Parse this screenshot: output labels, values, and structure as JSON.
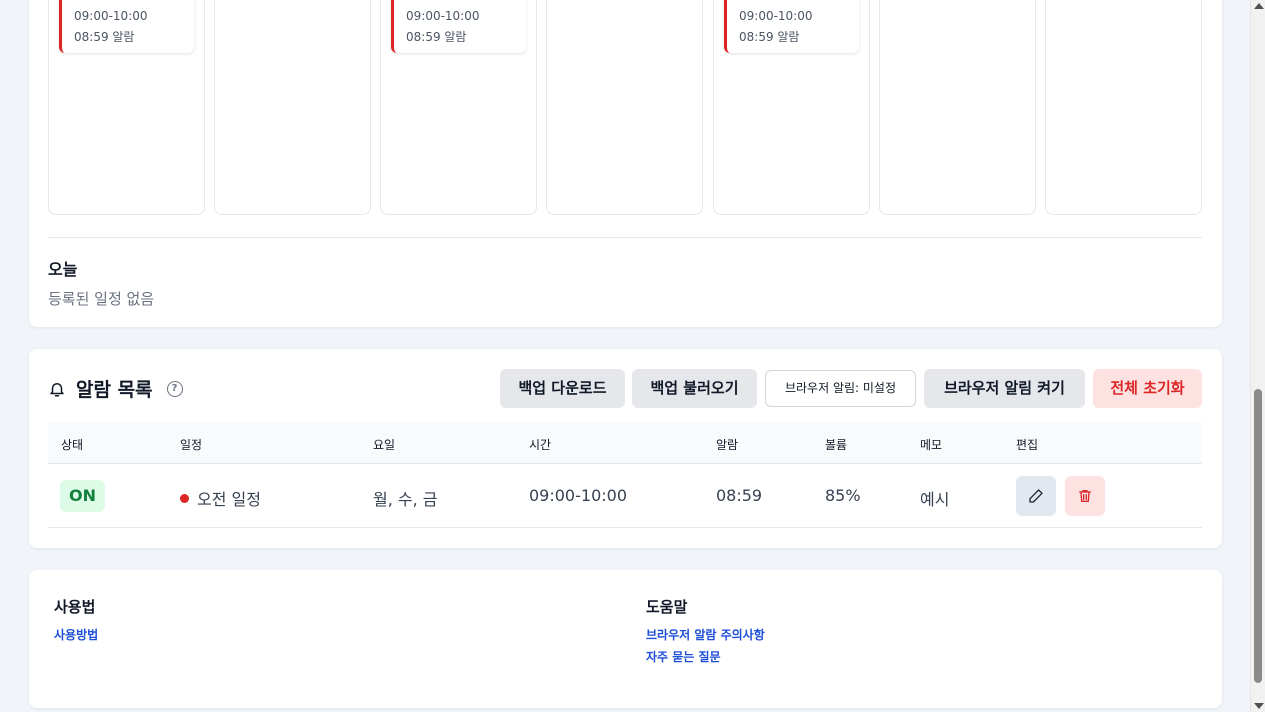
{
  "week": {
    "events": [
      {
        "time": "09:00-10:00",
        "alarm": "08:59 알람"
      },
      {
        "time": "09:00-10:00",
        "alarm": "08:59 알람"
      },
      {
        "time": "09:00-10:00",
        "alarm": "08:59 알람"
      }
    ],
    "today_title": "오늘",
    "today_empty": "등록된 일정 없음",
    "event_color": "#dc2626"
  },
  "alarms": {
    "title": "알람 목록",
    "help_icon": "?",
    "buttons": {
      "backup_download": "백업 다운로드",
      "backup_load": "백업 불러오기",
      "browser_status": "브라우저 알림: 미설정",
      "browser_enable": "브라우저 알림 켜기",
      "reset_all": "전체 초기화"
    },
    "columns": [
      "상태",
      "일정",
      "요일",
      "시간",
      "알람",
      "볼륨",
      "메모",
      "편집"
    ],
    "rows": [
      {
        "status": "ON",
        "name": "오전 일정",
        "days": "월, 수, 금",
        "time": "09:00-10:00",
        "alarm": "08:59",
        "volume": "85%",
        "memo": "예시"
      }
    ]
  },
  "help": {
    "usage_title": "사용법",
    "usage_link": "사용방법",
    "help_title": "도움말",
    "help_links": [
      "브라우저 알람 주의사항",
      "자주 묻는 질문"
    ]
  }
}
